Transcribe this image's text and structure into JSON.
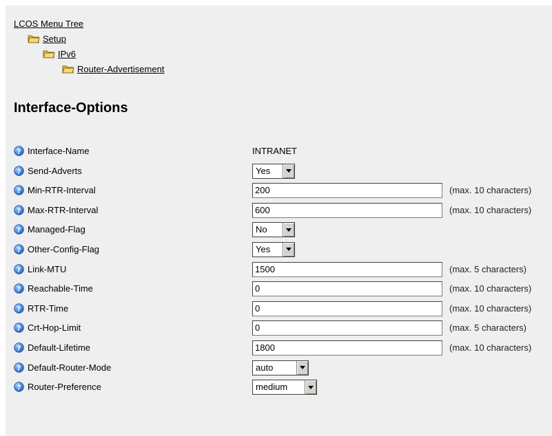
{
  "breadcrumb": {
    "root": "LCOS Menu Tree",
    "items": [
      "Setup",
      "IPv6",
      "Router-Advertisement"
    ]
  },
  "page_title": "Interface-Options",
  "fields": [
    {
      "label": "Interface-Name",
      "type": "text",
      "value": "INTRANET"
    },
    {
      "label": "Send-Adverts",
      "type": "select",
      "value": "Yes"
    },
    {
      "label": "Min-RTR-Interval",
      "type": "input",
      "value": "200",
      "hint": "(max. 10 characters)"
    },
    {
      "label": "Max-RTR-Interval",
      "type": "input",
      "value": "600",
      "hint": "(max. 10 characters)"
    },
    {
      "label": "Managed-Flag",
      "type": "select",
      "value": "No"
    },
    {
      "label": "Other-Config-Flag",
      "type": "select",
      "value": "Yes"
    },
    {
      "label": "Link-MTU",
      "type": "input",
      "value": "1500",
      "hint": "(max. 5 characters)"
    },
    {
      "label": "Reachable-Time",
      "type": "input",
      "value": "0",
      "hint": "(max. 10 characters)"
    },
    {
      "label": "RTR-Time",
      "type": "input",
      "value": "0",
      "hint": "(max. 10 characters)"
    },
    {
      "label": "Crt-Hop-Limit",
      "type": "input",
      "value": "0",
      "hint": "(max. 5 characters)"
    },
    {
      "label": "Default-Lifetime",
      "type": "input",
      "value": "1800",
      "hint": "(max. 10 characters)"
    },
    {
      "label": "Default-Router-Mode",
      "type": "select",
      "value": "auto"
    },
    {
      "label": "Router-Preference",
      "type": "select",
      "value": "medium"
    }
  ],
  "icons": {
    "folder": "folder-icon",
    "help": "help-icon"
  },
  "colors": {
    "background": "#efefef",
    "help_blue": "#2a6fd1"
  }
}
